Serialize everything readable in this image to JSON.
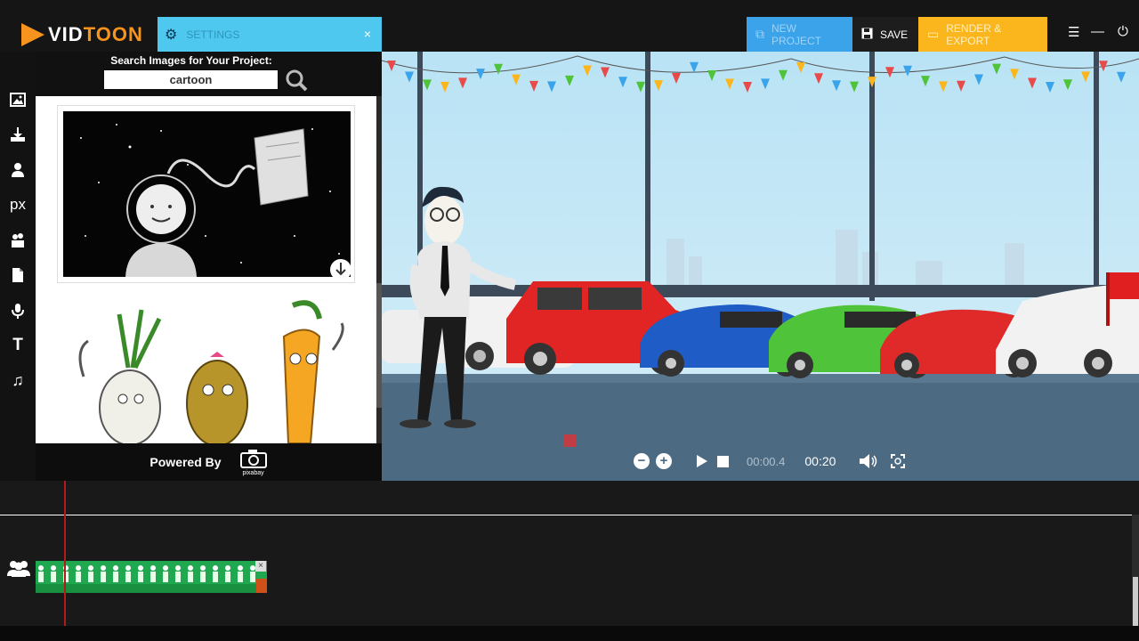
{
  "app": {
    "logo_vid": "VID",
    "logo_toon": "TOON"
  },
  "settings": {
    "label": "SETTINGS",
    "close": "×"
  },
  "toolbar_buttons": {
    "new_project": "NEW PROJECT",
    "save": "SAVE",
    "render": "RENDER & EXPORT"
  },
  "window": {
    "menu": "☰",
    "minimize": "—",
    "power": "⏻"
  },
  "sidebar": {
    "items": [
      {
        "icon": "image-icon"
      },
      {
        "icon": "download-icon"
      },
      {
        "icon": "user-icon"
      },
      {
        "icon": "pixabay-icon",
        "label": "px"
      },
      {
        "icon": "props-icon"
      },
      {
        "icon": "document-icon"
      },
      {
        "icon": "microphone-icon"
      },
      {
        "icon": "text-icon",
        "label": "T"
      },
      {
        "icon": "music-icon",
        "label": "♫"
      }
    ]
  },
  "library": {
    "search_title": "Search Images for Your Project:",
    "search_value": "cartoon",
    "powered_by": "Powered By",
    "powered_logo": "pixabay"
  },
  "playback": {
    "current_time": "00:00.4",
    "total_time": "00:20",
    "zoom_out": "−",
    "zoom_in": "+"
  },
  "colors": {
    "accent_blue": "#3aa3e9",
    "accent_cyan": "#4fc8f0",
    "accent_yellow": "#fbb61d",
    "brand_orange": "#f7941d",
    "clip_green": "#1fa84f",
    "playhead_red": "#b31b1b"
  }
}
